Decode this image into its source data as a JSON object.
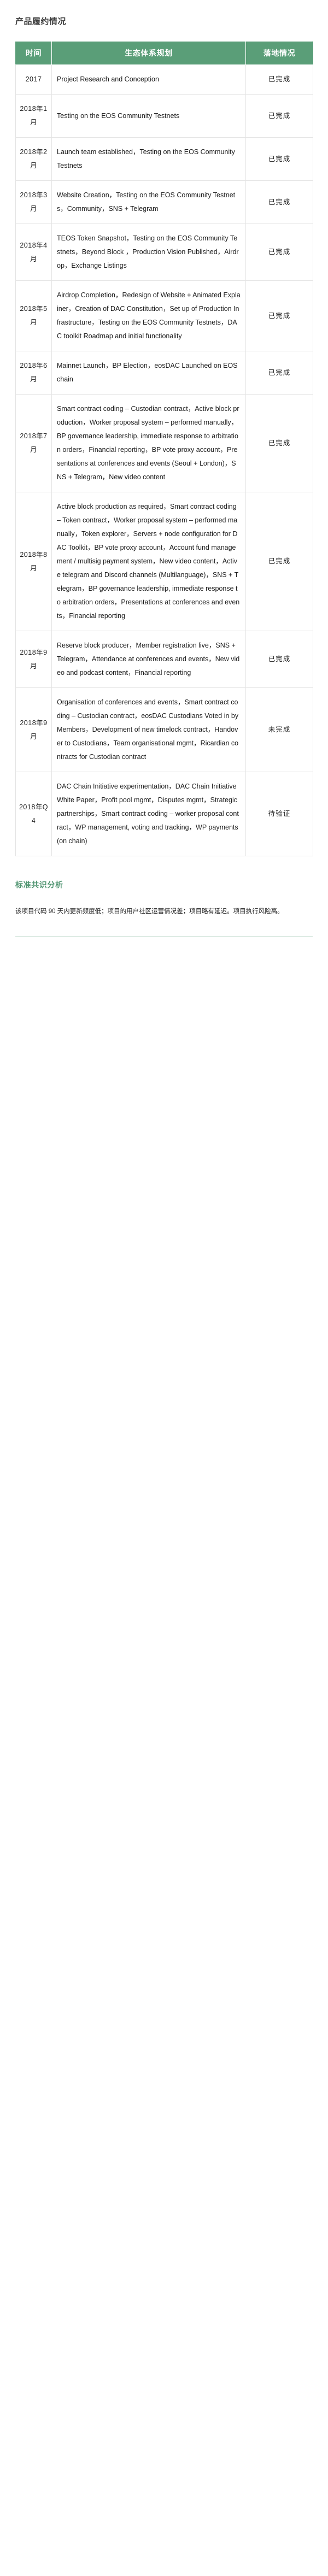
{
  "section": {
    "title": "产品履约情况"
  },
  "table": {
    "headers": {
      "time": "时间",
      "plan": "生态体系规划",
      "status": "落地情况"
    },
    "rows": [
      {
        "time": "2017",
        "plan": "Project Research and Conception",
        "status": "已完成"
      },
      {
        "time": "2018年1月",
        "plan": "Testing on the EOS Community Testnets",
        "status": "已完成"
      },
      {
        "time": "2018年2月",
        "plan": "Launch team established，Testing on the EOS Community Testnets",
        "status": "已完成"
      },
      {
        "time": "2018年3月",
        "plan": "Website Creation，Testing on the EOS Community Testnets，Community，SNS + Telegram",
        "status": "已完成"
      },
      {
        "time": "2018年4月",
        "plan": "TEOS Token Snapshot，Testing on the EOS Community Testnets，Beyond Block ，Production Vision Published，Airdrop，Exchange Listings",
        "status": "已完成"
      },
      {
        "time": "2018年5月",
        "plan": "Airdrop Completion，Redesign of Website + Animated Explainer，Creation of DAC Constitution，Set up of Production Infrastructure，Testing on the EOS Community Testnets，DAC toolkit Roadmap and initial functionality",
        "status": "已完成"
      },
      {
        "time": "2018年6月",
        "plan": "Mainnet Launch，BP Election，eosDAC Launched on EOS chain",
        "status": "已完成"
      },
      {
        "time": "2018年7月",
        "plan": "Smart contract coding – Custodian contract，Active block production，Worker proposal system – performed manually，BP governance leadership, immediate response to arbitration orders，Financial reporting，BP vote proxy account，Presentations at conferences and events (Seoul + London)，SNS + Telegram，New video content",
        "status": "已完成"
      },
      {
        "time": "2018年8月",
        "plan": "Active block production as required，Smart contract coding – Token contract，Worker proposal system – performed manually，Token explorer，Servers + node configuration for DAC Toolkit，BP vote proxy account，Account fund management / multisig payment system，New video content，Active telegram and Discord channels (Multilanguage)，SNS + Telegram，BP governance leadership, immediate response to arbitration orders，Presentations at conferences and events，Financial reporting",
        "status": "已完成"
      },
      {
        "time": "2018年9月",
        "plan": "Reserve block producer，Member registration live，SNS + Telegram，Attendance at conferences and events，New video and podcast content，Financial reporting",
        "status": "已完成"
      },
      {
        "time": "2018年9月",
        "plan": "Organisation of conferences and events，Smart contract coding – Custodian contract，eosDAC Custodians Voted in by Members，Development of new timelock contract，Handover to Custodians，Team organisational mgmt，Ricardian contracts for Custodian contract",
        "status": "未完成"
      },
      {
        "time": "2018年Q4",
        "plan": "DAC Chain Initiative experimentation，DAC Chain Initiative White Paper，Profit pool mgmt，Disputes mgmt，Strategic partnerships，Smart contract coding – worker proposal contract，WP management, voting and tracking，WP payments (on chain)",
        "status": "待验证"
      }
    ]
  },
  "analysis": {
    "title": "标准共识分析",
    "body": "该项目代码 90 天内更新频度低；项目的用户社区运营情况差；项目略有延迟。项目执行风险高。"
  },
  "colors": {
    "header_green": "#5a9e78",
    "accent_green": "#4f9470",
    "border_gray": "#e4e4e4"
  }
}
